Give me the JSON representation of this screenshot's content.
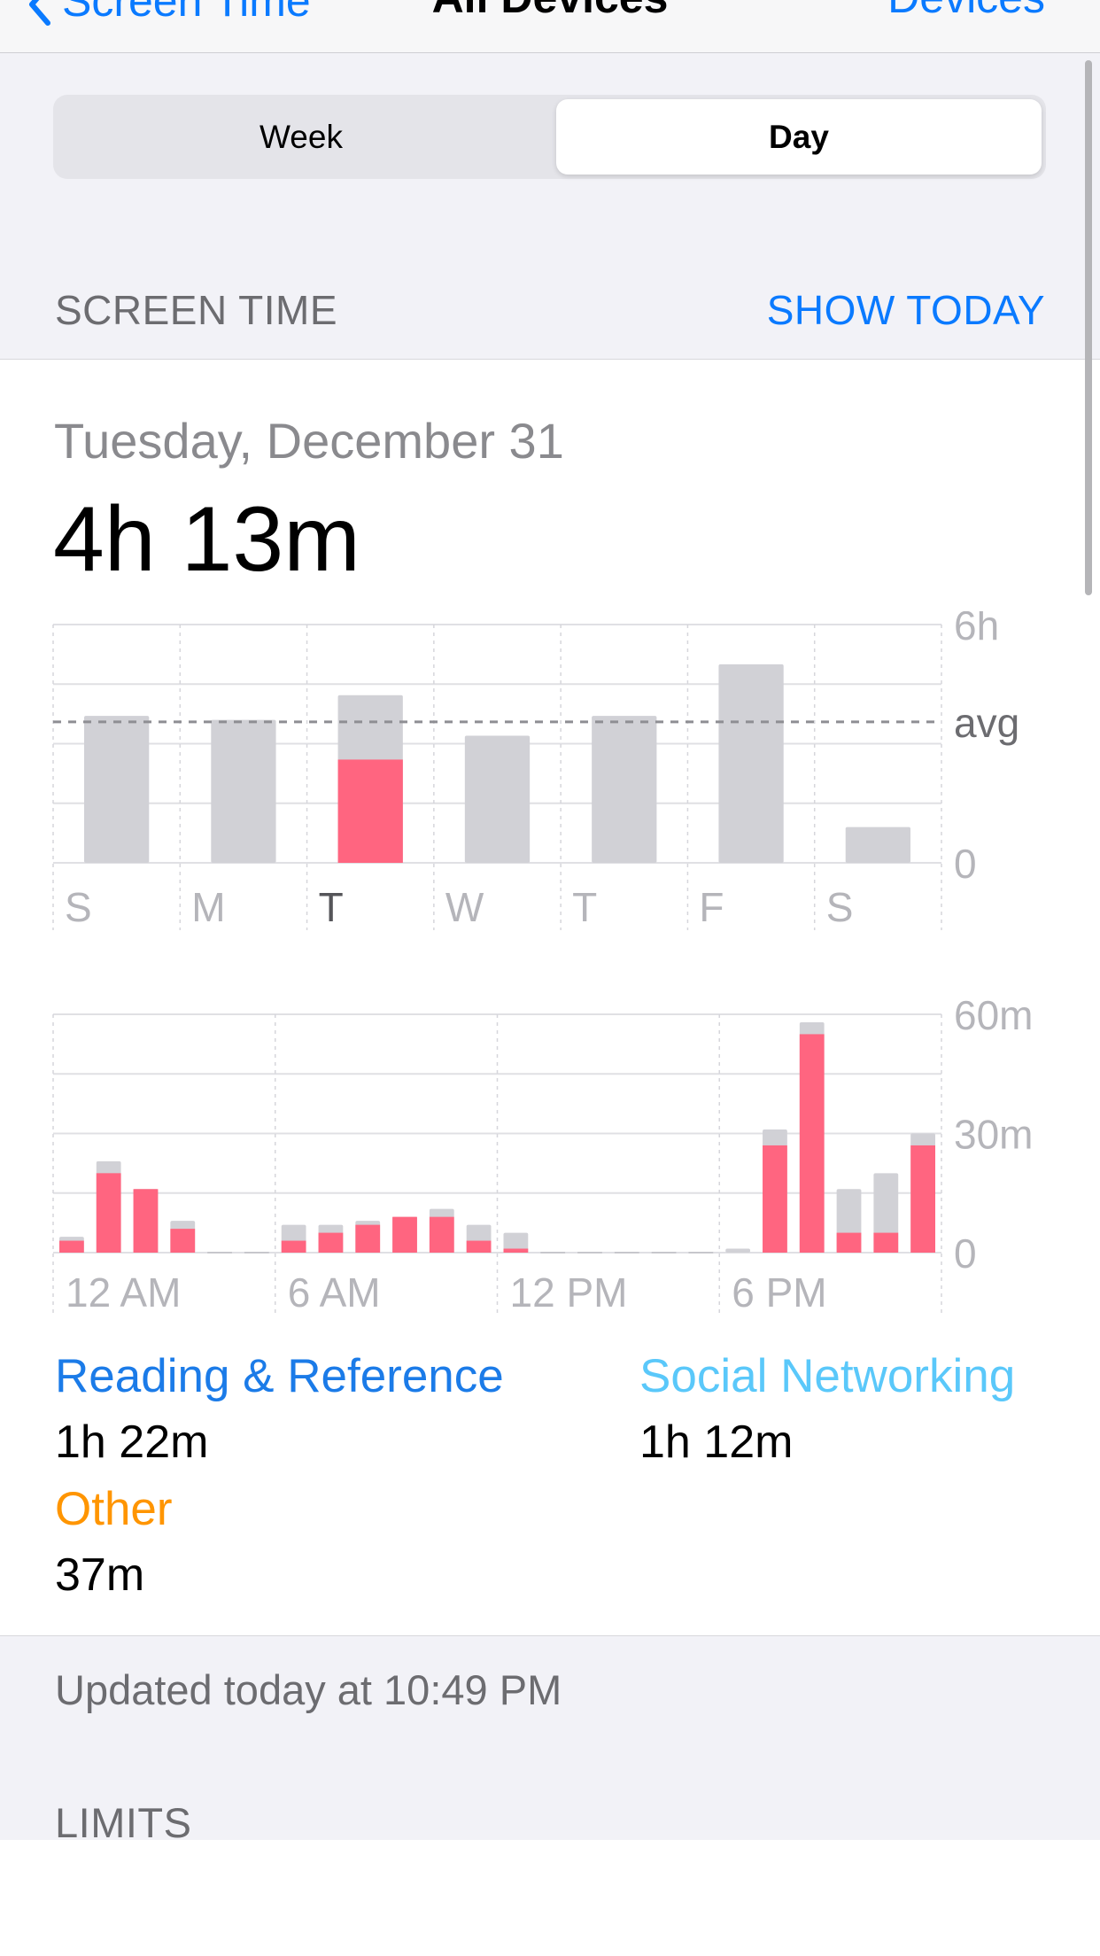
{
  "nav": {
    "back_label": "Screen Time",
    "title": "All Devices",
    "right_label": "Devices"
  },
  "segments": {
    "week": "Week",
    "day": "Day",
    "selected": "Day"
  },
  "section": {
    "title": "SCREEN TIME",
    "action": "SHOW TODAY"
  },
  "summary": {
    "date": "Tuesday, December 31",
    "total": "4h 13m"
  },
  "colors": {
    "accent": "#0a7aff",
    "highlight_bar": "#ff6580",
    "bar_gray": "#d1d1d6",
    "reading": "#1b7be8",
    "social": "#5ac8fa",
    "other": "#ff9500"
  },
  "chart_data": [
    {
      "type": "bar",
      "categories": [
        "S",
        "M",
        "T",
        "W",
        "T",
        "F",
        "S"
      ],
      "series": [
        {
          "values": [
            3.7,
            3.6,
            4.22,
            3.2,
            3.7,
            5.0,
            0.9
          ]
        }
      ],
      "highlighted_index": 2,
      "highlighted_value": 2.6,
      "ytick_labels": [
        "6h",
        "avg",
        "0"
      ],
      "ylim": [
        0,
        6
      ],
      "avg_value": 3.55,
      "grid": true
    },
    {
      "type": "bar",
      "x_labels": [
        "12 AM",
        "6 AM",
        "12 PM",
        "6 PM"
      ],
      "hours": [
        0,
        1,
        2,
        3,
        4,
        5,
        6,
        7,
        8,
        9,
        10,
        11,
        12,
        13,
        14,
        15,
        16,
        17,
        18,
        19,
        20,
        21,
        22,
        23
      ],
      "series": [
        {
          "name": "pink",
          "values": [
            3,
            20,
            16,
            6,
            0,
            0,
            3,
            5,
            7,
            9,
            9,
            3,
            1,
            0,
            0,
            0,
            0,
            0,
            0,
            27,
            55,
            5,
            5,
            27
          ]
        },
        {
          "name": "total",
          "values": [
            4,
            23,
            16,
            8,
            0,
            0,
            7,
            7,
            8,
            9,
            11,
            7,
            5,
            0,
            0,
            0,
            0,
            0,
            1,
            31,
            58,
            16,
            20,
            30
          ]
        }
      ],
      "ytick_labels": [
        "60m",
        "30m",
        "0"
      ],
      "ylim": [
        0,
        60
      ],
      "grid": true
    }
  ],
  "categories": [
    {
      "name": "Reading & Reference",
      "time": "1h 22m"
    },
    {
      "name": "Social Networking",
      "time": "1h 12m"
    },
    {
      "name": "Other",
      "time": "37m"
    }
  ],
  "footer": {
    "updated": "Updated today at 10:49 PM",
    "limits_title": "LIMITS"
  }
}
